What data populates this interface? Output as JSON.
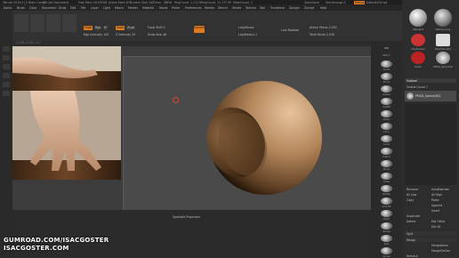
{
  "titlebar": {
    "items": [
      "ZBrush 2019.1 [2 Brain Core]",
      "ZBrush Document",
      "Free Mem 16.905GB",
      "Active Mem 671",
      "Scratch Disk 162",
      "Timer",
      "ZBR#",
      "PolyCount",
      "1.112 K",
      "PolyCount",
      "11.177 KP",
      "MeshCount",
      "1"
    ],
    "right": [
      "QuickSave",
      "See-through 0",
      "Menus",
      "DefaultZScript"
    ]
  },
  "menubar": {
    "items": [
      "Alpha",
      "Brush",
      "Color",
      "Document",
      "Draw",
      "Edit",
      "File",
      "Layer",
      "Light",
      "Macro",
      "Marker",
      "Material",
      "Movie",
      "Picker",
      "Preferences",
      "Render",
      "Stencil",
      "Stroke",
      "Texture",
      "Tool",
      "Transform",
      "Zplugin",
      "Zscript",
      "Help"
    ]
  },
  "coords": "0.156,-0.912,-0.7",
  "shelf": {
    "mrgb": "Mrgb",
    "rgb": "Rgb",
    "m": "M",
    "zadd": "Zadd",
    "zsub": "Zsub",
    "rgb_intensity": "Rgb Intensity 100",
    "z_intensity": "Z Intensity 25",
    "focal_shift": "Focal Shift 0",
    "draw_size": "Draw Size 46",
    "dynamic": "Dynamic",
    "lazymouse": "LazyMouse",
    "lazyradius": "LazyRadius 1",
    "live_boolean": "Live Boolean",
    "active_points": "Active Points 2,030",
    "total_points": "Total Points 2,030"
  },
  "rightshelf": {
    "items": [
      "BPR",
      "SPix 3",
      "Scroll",
      "Zoom",
      "Actual",
      "AAHalf",
      "Persp",
      "Floor",
      "Local",
      "Frame",
      "Move",
      "Scale",
      "Rotate",
      "Line Fill",
      "PolyF",
      "Transp",
      "Solo",
      "Xpose"
    ]
  },
  "tray": {
    "brushes": [
      "Standard",
      "MatCap Gray",
      "ClayBuildup",
      "DamStandard",
      "Polish",
      "PM3D_Sphere3D"
    ],
    "subtool_header": "Subtool",
    "subtool_item": "PM3D_Sphere3D1",
    "visible_count": "Visible Count 7",
    "rows": [
      "Rename",
      "AutoReorder",
      "All Low",
      "All High",
      "Copy",
      "Paste",
      "Append",
      "Insert",
      "Duplicate",
      "Delete",
      "Del Other",
      "Del All",
      "Split",
      "Merge",
      "MergeDown",
      "MergeSimilar",
      "Remesh"
    ]
  },
  "bottombar": {
    "label": "Spotlight Projection"
  },
  "watermark": {
    "line1": "GUMROAD.COM/ISACGOSTER",
    "line2": "ISACGOSTER.COM"
  },
  "colors": {
    "accent": "#e07b22",
    "background": "#2c2c2c",
    "sphere_light": "#c9a27a",
    "sphere_dark": "#4a3320"
  }
}
